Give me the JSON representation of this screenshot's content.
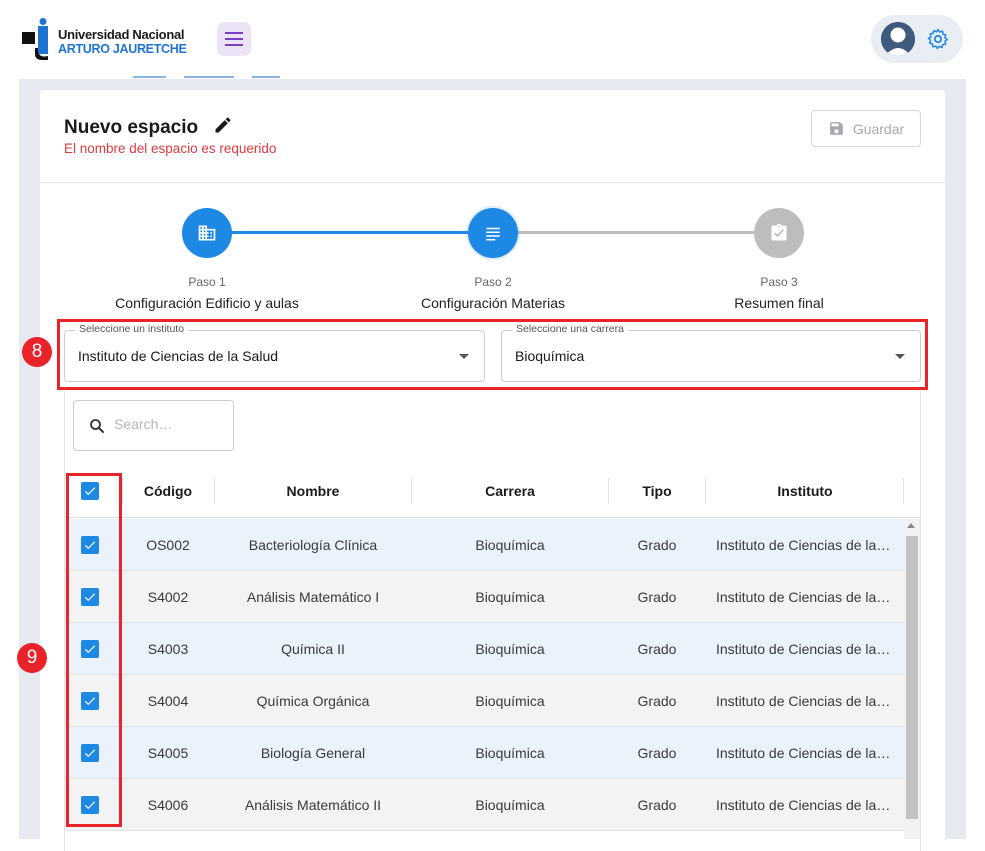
{
  "brand": {
    "line1": "Universidad Nacional",
    "line2": "ARTURO JAURETCHE"
  },
  "page": {
    "title": "Nuevo espacio",
    "error": "El nombre del espacio es requerido",
    "save_label": "Guardar"
  },
  "steps": [
    {
      "num": "Paso 1",
      "name": "Configuración Edificio y aulas",
      "state": "done",
      "icon": "building-icon"
    },
    {
      "num": "Paso 2",
      "name": "Configuración Materias",
      "state": "active",
      "icon": "list-icon"
    },
    {
      "num": "Paso 3",
      "name": "Resumen final",
      "state": "pending",
      "icon": "clipboard-check-icon"
    }
  ],
  "filters": {
    "institute": {
      "label": "Seleccione un instituto",
      "value": "Instituto de Ciencias de la Salud"
    },
    "career": {
      "label": "Seleccione una carrera",
      "value": "Bioquímica"
    }
  },
  "annotations": {
    "badge_filters": "8",
    "badge_checks": "9"
  },
  "search": {
    "placeholder": "Search…"
  },
  "table": {
    "headers": {
      "code": "Código",
      "name": "Nombre",
      "career": "Carrera",
      "type": "Tipo",
      "institute": "Instituto"
    },
    "rows": [
      {
        "code": "OS002",
        "name": "Bacteriología Clínica",
        "career": "Bioquímica",
        "type": "Grado",
        "institute": "Instituto de Ciencias de la Salud",
        "checked": true
      },
      {
        "code": "S4002",
        "name": "Análisis Matemático I",
        "career": "Bioquímica",
        "type": "Grado",
        "institute": "Instituto de Ciencias de la Salud",
        "checked": true
      },
      {
        "code": "S4003",
        "name": "Química II",
        "career": "Bioquímica",
        "type": "Grado",
        "institute": "Instituto de Ciencias de la Salud",
        "checked": true
      },
      {
        "code": "S4004",
        "name": "Química Orgánica",
        "career": "Bioquímica",
        "type": "Grado",
        "institute": "Instituto de Ciencias de la Salud",
        "checked": true
      },
      {
        "code": "S4005",
        "name": "Biología General",
        "career": "Bioquímica",
        "type": "Grado",
        "institute": "Instituto de Ciencias de la Salud",
        "checked": true
      },
      {
        "code": "S4006",
        "name": "Análisis Matemático II",
        "career": "Bioquímica",
        "type": "Grado",
        "institute": "Instituto de Ciencias de la Salud",
        "checked": true
      }
    ]
  },
  "colors": {
    "primary": "#1e88e5",
    "highlight": "#e8242a",
    "pending": "#bdbdbd",
    "error": "#e0393e"
  }
}
